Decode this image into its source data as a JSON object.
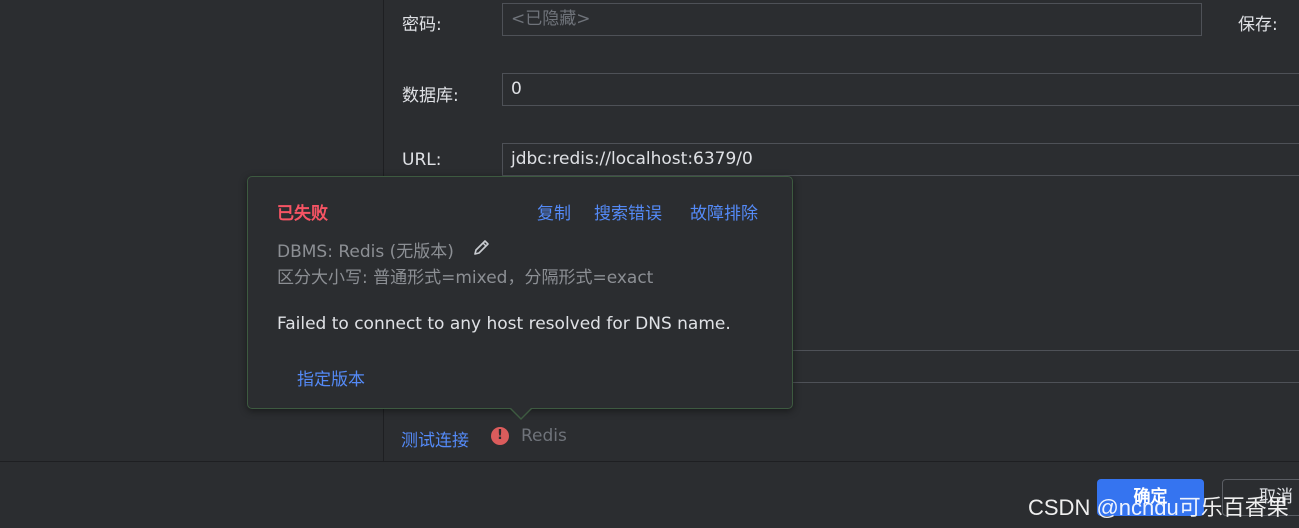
{
  "form": {
    "password_label": "密码:",
    "password_placeholder": "<已隐藏>",
    "save_label": "保存:",
    "database_label": "数据库:",
    "database_value": "0",
    "url_label": "URL:",
    "url_value": "jdbc:redis://localhost:6379/0"
  },
  "test": {
    "link_label": "测试连接",
    "status_icon": "error-icon",
    "driver": "Redis"
  },
  "popup": {
    "status": "已失败",
    "actions": [
      "复制",
      "搜索错误",
      "故障排除"
    ],
    "dbms": "DBMS: Redis (无版本)",
    "case_sensitivity": "区分大小写: 普通形式=mixed，分隔形式=exact",
    "message": "Failed to connect to any host resolved for DNS name.",
    "specify_version": "指定版本"
  },
  "buttons": {
    "ok": "确定",
    "cancel": "取消"
  },
  "watermark": "CSDN @ncndu可乐百香果",
  "colors": {
    "accent": "#3574f0",
    "link": "#548af7",
    "error": "#f75464"
  }
}
